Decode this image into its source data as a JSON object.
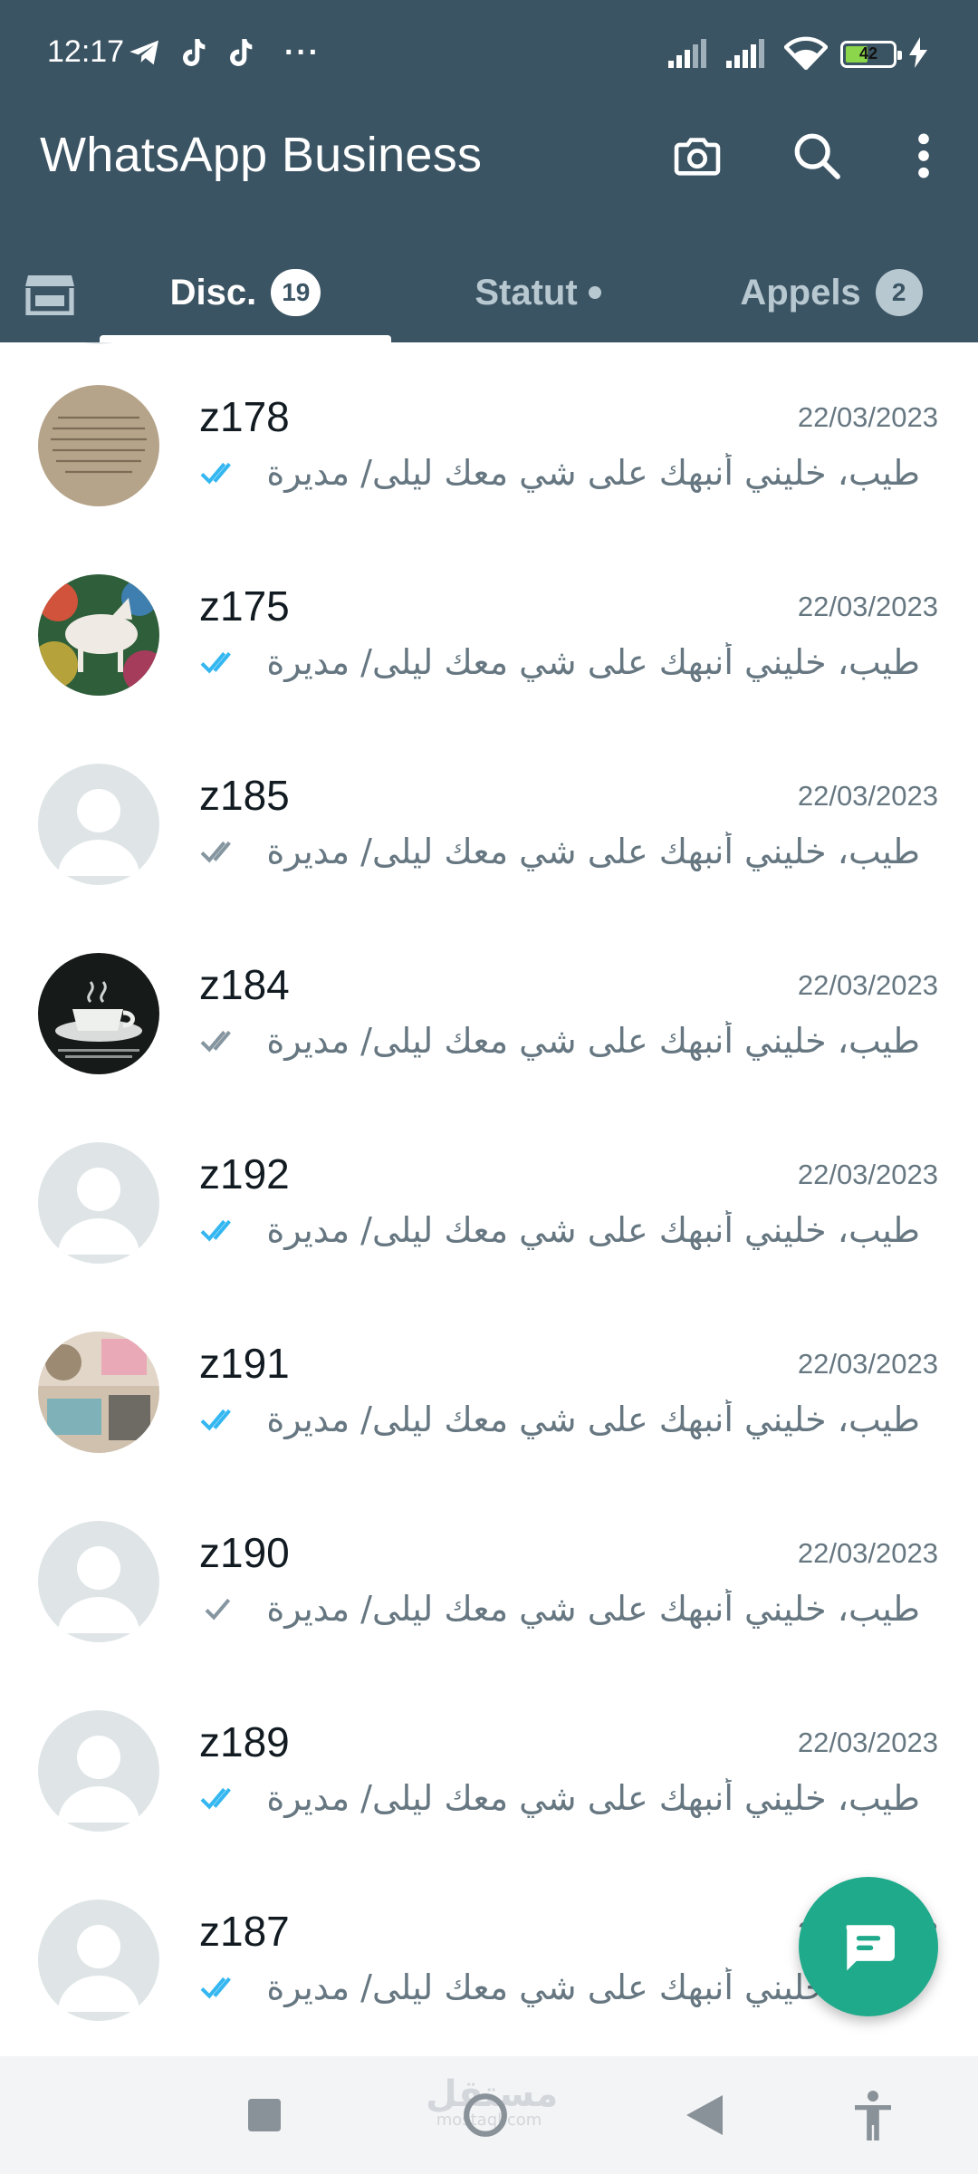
{
  "status_bar": {
    "time": "12:17",
    "more": "···",
    "battery": "42"
  },
  "header": {
    "title": "WhatsApp Business",
    "camera_icon": "camera-icon",
    "search_icon": "search-icon",
    "menu_icon": "more-vertical-icon",
    "background_color": "#3b5463"
  },
  "tabs": {
    "store_icon": "store-icon",
    "items": [
      {
        "label": "Disc.",
        "badge": "19",
        "active": true
      },
      {
        "label": "Statut",
        "indicator": "dot",
        "active": false
      },
      {
        "label": "Appels",
        "badge": "2",
        "active": false
      }
    ]
  },
  "chats": [
    {
      "name": "z178",
      "date": "22/03/2023",
      "preview": "طيب، خليني أنبهك على شي معك ليلى/ مديرة ح...",
      "ticks": "double-blue",
      "avatar": "text-photo"
    },
    {
      "name": "z175",
      "date": "22/03/2023",
      "preview": "طيب، خليني أنبهك على شي معك ليلى/ مديرة ح...",
      "ticks": "double-blue",
      "avatar": "painting-photo"
    },
    {
      "name": "z185",
      "date": "22/03/2023",
      "preview": "طيب، خليني أنبهك على شي معك ليلى/ مديرة ح...",
      "ticks": "double-grey",
      "avatar": "default"
    },
    {
      "name": "z184",
      "date": "22/03/2023",
      "preview": "طيب، خليني أنبهك على شي معك ليلى/ مديرة ح...",
      "ticks": "double-grey",
      "avatar": "coffee-photo"
    },
    {
      "name": "z192",
      "date": "22/03/2023",
      "preview": "طيب، خليني أنبهك على شي معك ليلى/ مديرة ح...",
      "ticks": "double-blue",
      "avatar": "default"
    },
    {
      "name": "z191",
      "date": "22/03/2023",
      "preview": "طيب، خليني أنبهك على شي معك ليلى/ مديرة ح...",
      "ticks": "double-blue",
      "avatar": "room-photo"
    },
    {
      "name": "z190",
      "date": "22/03/2023",
      "preview": "طيب، خليني أنبهك على شي معك ليلى/ مديرة ح...",
      "ticks": "single-grey",
      "avatar": "default"
    },
    {
      "name": "z189",
      "date": "22/03/2023",
      "preview": "طيب، خليني أنبهك على شي معك ليلى/ مديرة ح...",
      "ticks": "double-blue",
      "avatar": "default"
    },
    {
      "name": "z187",
      "date": "22/03/2023",
      "preview": "طيب، خليني أنبهك على شي معك ليلى/ مديرة ح...",
      "ticks": "double-blue",
      "avatar": "default"
    }
  ],
  "fab": {
    "icon": "new-chat-icon",
    "color": "#1faa8b"
  },
  "nav": {
    "watermark": "مستقل",
    "watermark_domain": "mostaql.com",
    "recents_icon": "square-icon",
    "home_icon": "circle-icon",
    "back_icon": "triangle-back-icon",
    "accessibility_icon": "accessibility-icon"
  },
  "colors": {
    "tick_read": "#34b7f1",
    "tick_unread": "#8696a0",
    "accent": "#1faa8b"
  }
}
